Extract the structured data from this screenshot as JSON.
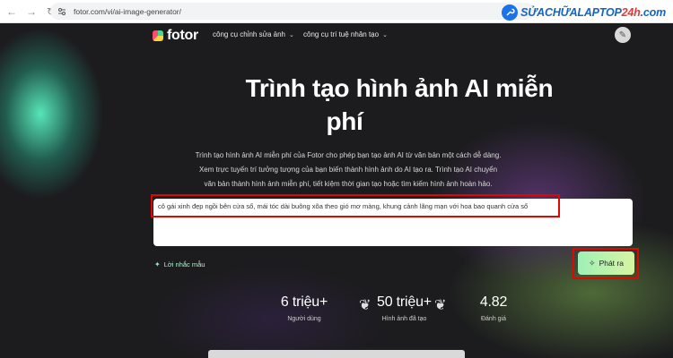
{
  "browser": {
    "url": "fotor.com/vi/ai-image-generator/",
    "brand": {
      "part1": "SỬACHỮALAPTOP",
      "part2": "24h",
      "part3": ".com"
    }
  },
  "header": {
    "logo": "fotor",
    "menu": [
      "công cụ chỉnh sửa ảnh",
      "công cụ trí tuệ nhân tạo"
    ]
  },
  "hero": {
    "title_line1": "Trình tạo hình ảnh AI miễn",
    "title_line2": "phí",
    "desc_line1": "Trình tạo hình ảnh AI miễn phí của Fotor cho phép bạn tạo ảnh AI từ văn bản một cách dễ dàng.",
    "desc_line2": "Xem trực tuyến trí tưởng tượng của bạn biến thành hình ảnh do AI tạo ra. Trình tạo AI chuyển",
    "desc_line3": "văn bản thành hình ảnh miễn phí, tiết kiệm thời gian tạo hoặc tìm kiếm hình ảnh hoàn hảo."
  },
  "prompt": {
    "value": "cô gái xinh đẹp ngồi bên cửa sổ, mái tóc dài buông xõa theo gió mơ màng, khung cảnh lãng mạn với hoa bao quanh cửa sổ"
  },
  "hints_label": "Lời nhắc mẫu",
  "generate_label": "Phát ra",
  "stats": [
    {
      "value": "6 triệu+",
      "label": "Người dùng"
    },
    {
      "value": "50 triệu+",
      "label": "Hình ảnh đã tạo"
    },
    {
      "value": "4.82",
      "label": "Đánh giá"
    }
  ],
  "colors": {
    "highlight_border": "#e10600",
    "generate_button": "#a8f0b4",
    "background": "#1c1c1e"
  }
}
